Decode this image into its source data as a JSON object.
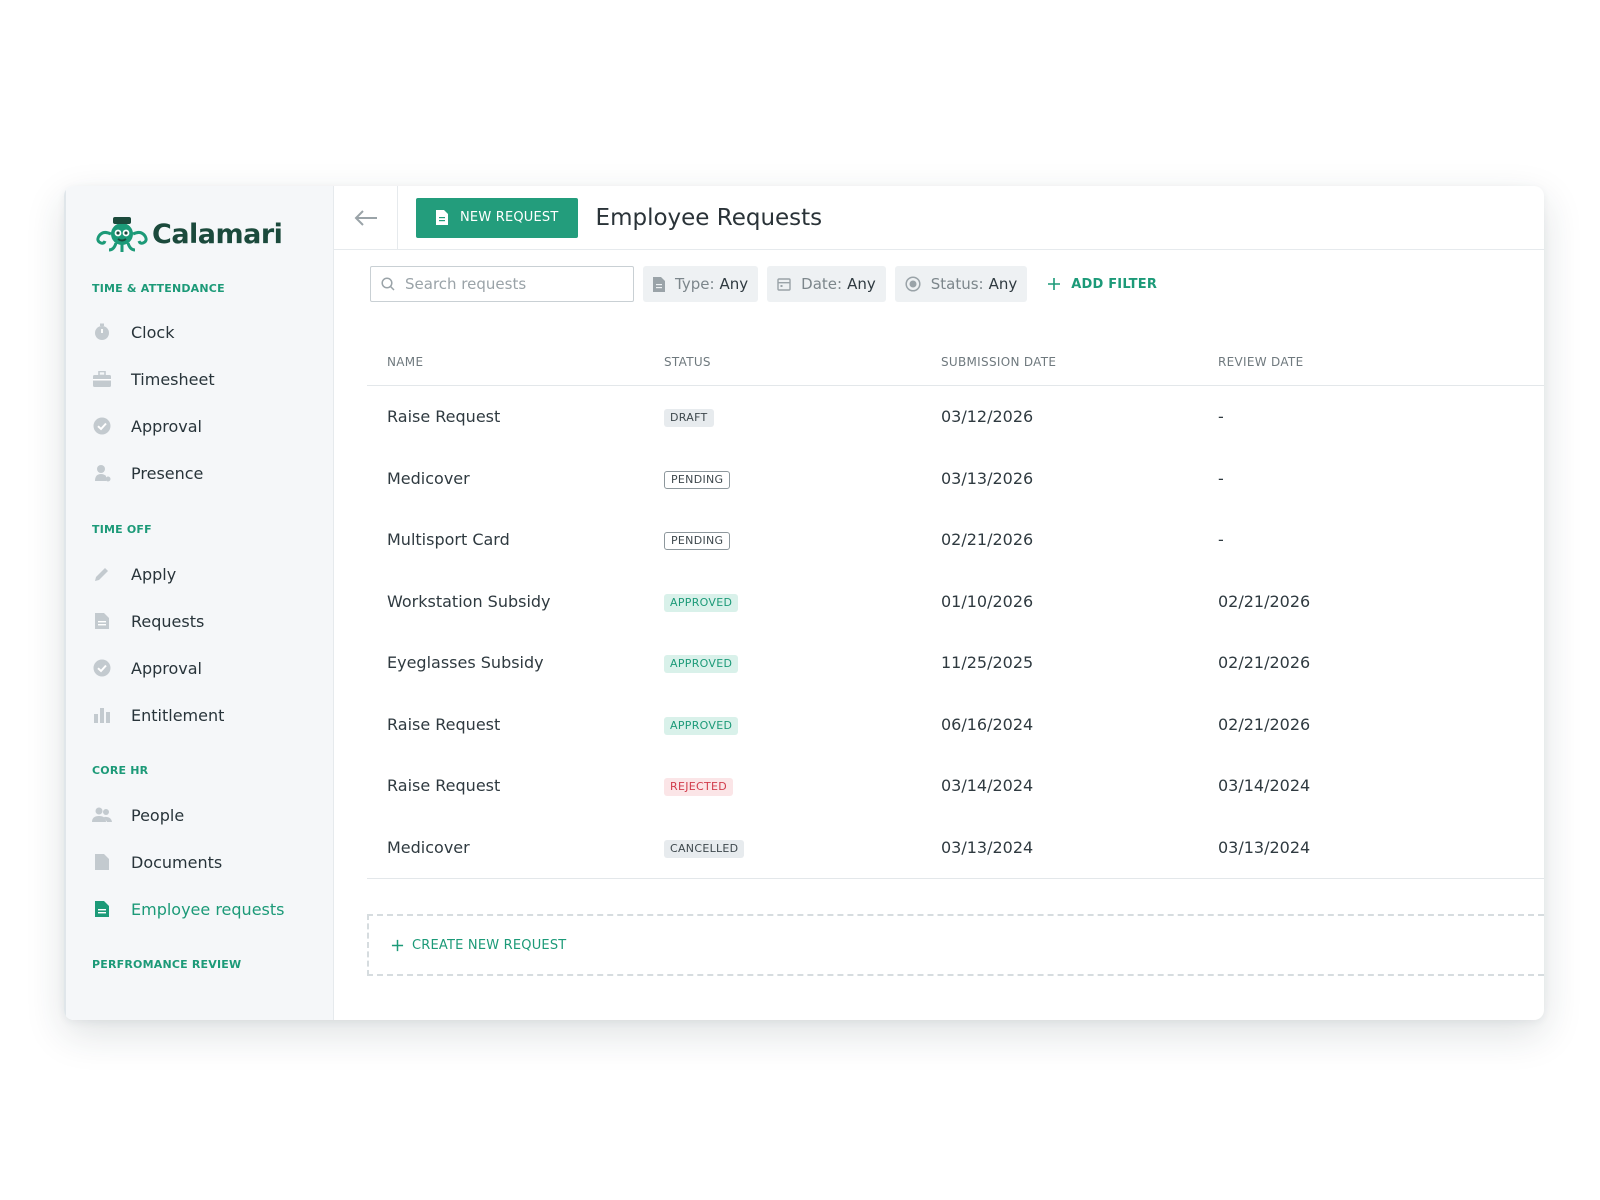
{
  "brand": {
    "name": "Calamari"
  },
  "sidebar": {
    "sections": [
      {
        "title": "TIME & ATTENDANCE",
        "items": [
          {
            "label": "Clock",
            "icon": "stopwatch-icon"
          },
          {
            "label": "Timesheet",
            "icon": "briefcase-icon"
          },
          {
            "label": "Approval",
            "icon": "check-circle-icon"
          },
          {
            "label": "Presence",
            "icon": "person-pin-icon"
          }
        ]
      },
      {
        "title": "TIME OFF",
        "items": [
          {
            "label": "Apply",
            "icon": "pencil-icon"
          },
          {
            "label": "Requests",
            "icon": "document-icon"
          },
          {
            "label": "Approval",
            "icon": "check-circle-icon"
          },
          {
            "label": "Entitlement",
            "icon": "bar-chart-icon"
          }
        ]
      },
      {
        "title": "CORE HR",
        "items": [
          {
            "label": "People",
            "icon": "people-icon"
          },
          {
            "label": "Documents",
            "icon": "folder-doc-icon"
          },
          {
            "label": "Employee requests",
            "icon": "document-icon",
            "active": true
          }
        ]
      },
      {
        "title": "PERFROMANCE REVIEW",
        "items": []
      }
    ]
  },
  "header": {
    "new_request_label": "NEW REQUEST",
    "title": "Employee Requests"
  },
  "filters": {
    "search_placeholder": "Search requests",
    "type": {
      "key": "Type:",
      "value": "Any"
    },
    "date": {
      "key": "Date:",
      "value": "Any"
    },
    "status": {
      "key": "Status:",
      "value": "Any"
    },
    "add_filter_label": "ADD FILTER"
  },
  "table": {
    "columns": [
      "NAME",
      "STATUS",
      "SUBMISSION DATE",
      "REVIEW DATE"
    ],
    "rows": [
      {
        "name": "Raise Request",
        "status": "DRAFT",
        "submitted": "03/12/2026",
        "reviewed": "-"
      },
      {
        "name": "Medicover",
        "status": "PENDING",
        "submitted": "03/13/2026",
        "reviewed": "-"
      },
      {
        "name": "Multisport Card",
        "status": "PENDING",
        "submitted": "02/21/2026",
        "reviewed": "-"
      },
      {
        "name": "Workstation Subsidy",
        "status": "APPROVED",
        "submitted": "01/10/2026",
        "reviewed": "02/21/2026"
      },
      {
        "name": "Eyeglasses Subsidy",
        "status": "APPROVED",
        "submitted": "11/25/2025",
        "reviewed": "02/21/2026"
      },
      {
        "name": "Raise Request",
        "status": "APPROVED",
        "submitted": "06/16/2024",
        "reviewed": "02/21/2026"
      },
      {
        "name": "Raise Request",
        "status": "REJECTED",
        "submitted": "03/14/2024",
        "reviewed": "03/14/2024"
      },
      {
        "name": "Medicover",
        "status": "CANCELLED",
        "submitted": "03/13/2024",
        "reviewed": "03/13/2024"
      }
    ]
  },
  "footer": {
    "create_label": "CREATE NEW REQUEST"
  },
  "colors": {
    "accent": "#239d7c",
    "accent_text": "#1c9a78",
    "brand_dark": "#1b4a3c"
  }
}
